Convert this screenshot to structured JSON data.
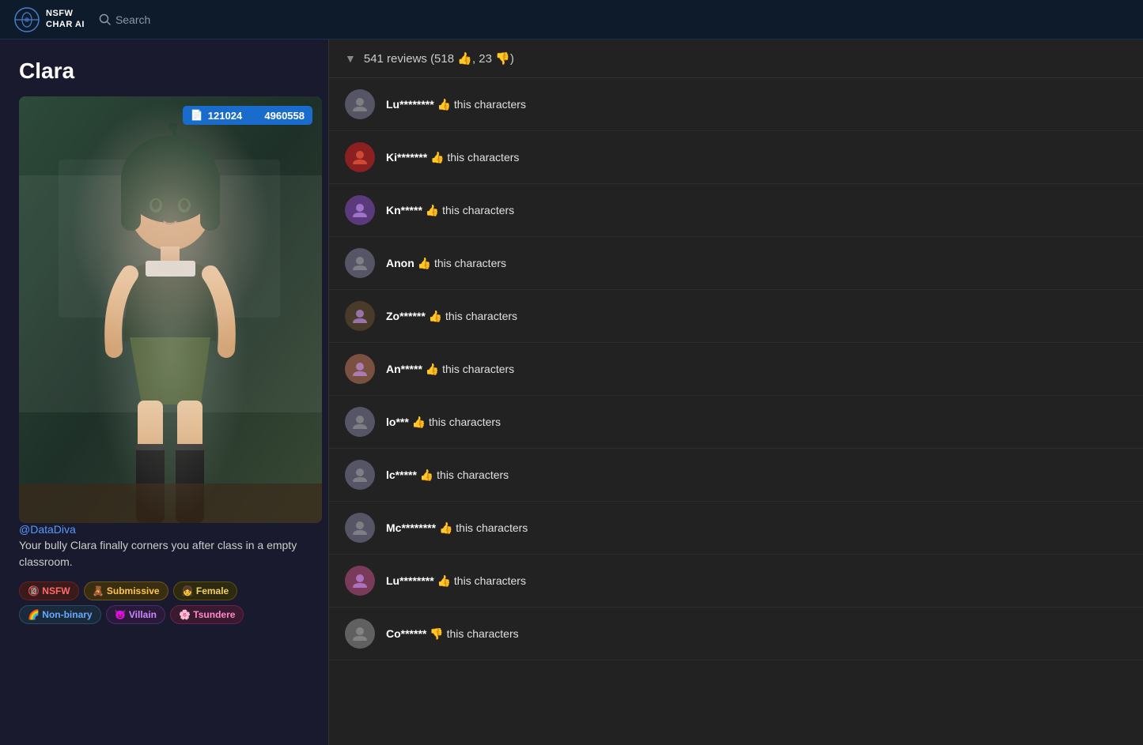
{
  "app": {
    "brand_line1": "NSFW",
    "brand_line2": "CHAR AI",
    "search_label": "Search"
  },
  "character": {
    "name": "Clara",
    "stats_token": "121024",
    "stats_hearts": "4960558",
    "author": "@DataDiva",
    "description": "Your bully Clara finally corners you after class in a empty classroom.",
    "tags": [
      {
        "id": "nsfw",
        "label": "NSFW",
        "emoji": "🔞",
        "cls": "tag-nsfw"
      },
      {
        "id": "submissive",
        "label": "Submissive",
        "emoji": "🧸",
        "cls": "tag-submissive"
      },
      {
        "id": "female",
        "label": "Female",
        "emoji": "👧",
        "cls": "tag-female"
      },
      {
        "id": "nonbinary",
        "label": "Non-binary",
        "emoji": "🌈",
        "cls": "tag-nonbinary"
      },
      {
        "id": "villain",
        "label": "Villain",
        "emoji": "😈",
        "cls": "tag-villain"
      },
      {
        "id": "tsundere",
        "label": "Tsundere",
        "emoji": "🌸",
        "cls": "tag-tsundere"
      }
    ]
  },
  "reviews": {
    "header_label": "541 reviews (518",
    "positive_count": "518",
    "negative_count": "23",
    "items": [
      {
        "id": 1,
        "user": "Lu********",
        "thumb": "👍",
        "text": "this characters",
        "avatar_type": "gray"
      },
      {
        "id": 2,
        "user": "Ki*******",
        "thumb": "👍",
        "text": "this characters",
        "avatar_type": "red-hat"
      },
      {
        "id": 3,
        "user": "Kn*****",
        "thumb": "👍",
        "text": "this characters",
        "avatar_type": "purple"
      },
      {
        "id": 4,
        "user": "Anon",
        "thumb": "👍",
        "text": "this characters",
        "avatar_type": "gray"
      },
      {
        "id": 5,
        "user": "Zo******",
        "thumb": "👍",
        "text": "this characters",
        "avatar_type": "striped"
      },
      {
        "id": 6,
        "user": "An*****",
        "thumb": "👍",
        "text": "this characters",
        "avatar_type": "peach"
      },
      {
        "id": 7,
        "user": "lo***",
        "thumb": "👍",
        "text": "this characters",
        "avatar_type": "gray"
      },
      {
        "id": 8,
        "user": "lc*****",
        "thumb": "👍",
        "text": "this characters",
        "avatar_type": "gray"
      },
      {
        "id": 9,
        "user": "Mc********",
        "thumb": "👍",
        "text": "this characters",
        "avatar_type": "gray"
      },
      {
        "id": 10,
        "user": "Lu********",
        "thumb": "👍",
        "text": "this characters",
        "avatar_type": "pink"
      },
      {
        "id": 11,
        "user": "Co******",
        "thumb": "👎",
        "text": "this characters",
        "avatar_type": "light-gray"
      }
    ]
  }
}
